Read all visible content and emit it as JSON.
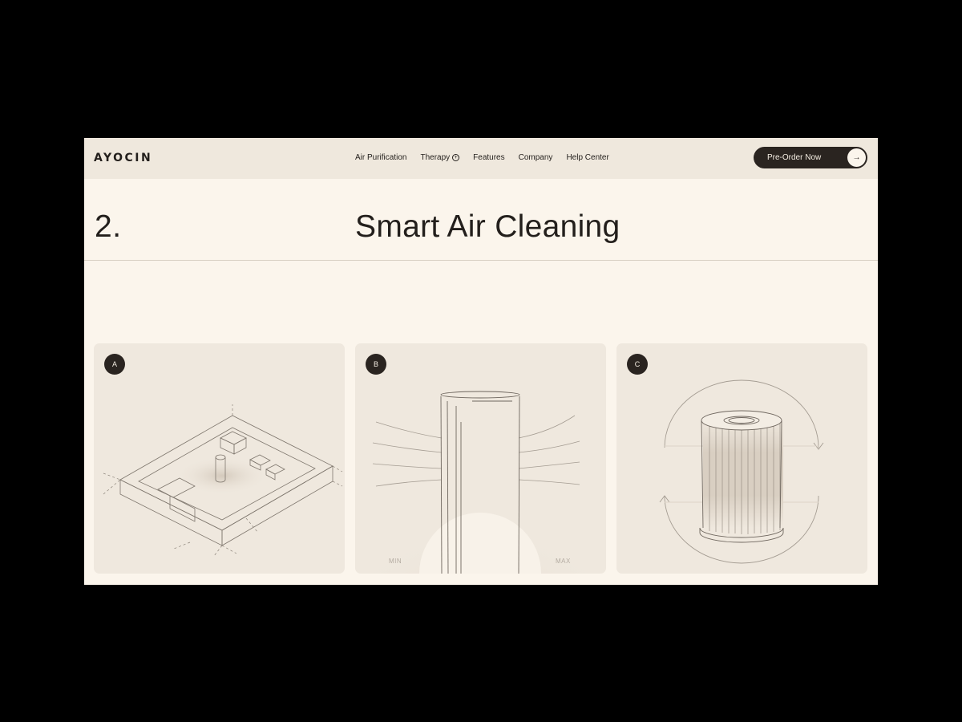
{
  "brand": {
    "logo": "AYOCIN"
  },
  "nav": {
    "items": [
      {
        "label": "Air Purification"
      },
      {
        "label": "Therapy"
      },
      {
        "label": "Features"
      },
      {
        "label": "Company"
      },
      {
        "label": "Help Center"
      }
    ],
    "therapy_icon": "plus-circle-icon"
  },
  "cta": {
    "label": "Pre-Order Now",
    "icon": "arrow-right-icon"
  },
  "section": {
    "number": "2.",
    "title": "Smart Air Cleaning"
  },
  "cards": [
    {
      "badge": "A",
      "illustration": "isometric-room"
    },
    {
      "badge": "B",
      "illustration": "air-tower",
      "scale_min": "MIN",
      "scale_max": "MAX"
    },
    {
      "badge": "C",
      "illustration": "rotating-filter"
    }
  ],
  "colors": {
    "background": "#fbf5ec",
    "navbar": "#efe8dd",
    "card": "#efe8de",
    "dark": "#2a2420",
    "outer": "#000000"
  }
}
